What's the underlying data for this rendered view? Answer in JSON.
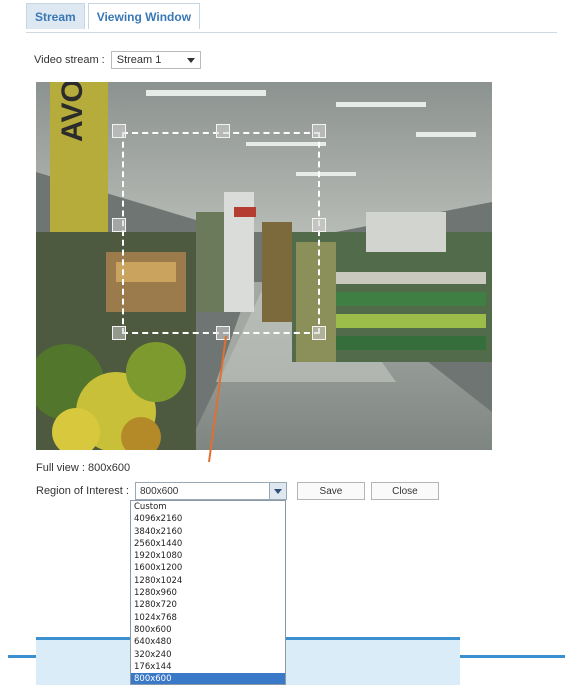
{
  "tabs": [
    {
      "label": "Stream",
      "active": false
    },
    {
      "label": "Viewing Window",
      "active": true
    }
  ],
  "video_stream": {
    "label": "Video stream :",
    "value": "Stream 1"
  },
  "full_view": "Full view : 800x600",
  "region": {
    "label": "Region of Interest :",
    "value": "800x600"
  },
  "buttons": {
    "save": "Save",
    "close": "Close"
  },
  "dropdown_items": [
    "Custom",
    "4096x2160",
    "3840x2160",
    "2560x1440",
    "1920x1080",
    "1600x1200",
    "1280x1024",
    "1280x960",
    "1280x720",
    "1024x768",
    "800x600",
    "640x480",
    "320x240",
    "176x144",
    "800x600"
  ],
  "colors": {
    "accent": "#3a78b5",
    "pointer": "#e07030",
    "selected": "#3a78c8",
    "panel": "#d9ecf8"
  }
}
